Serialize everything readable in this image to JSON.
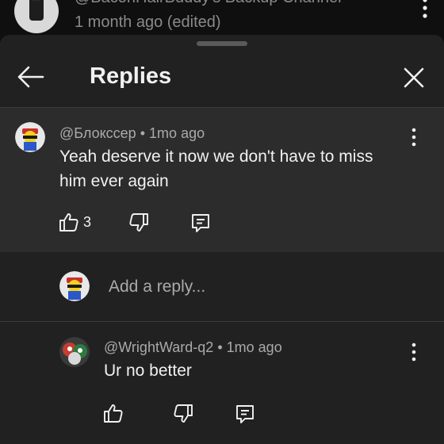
{
  "background_comment": {
    "author": "@BaconHairBuddy's Backup Channel",
    "time": "1 month ago (edited)"
  },
  "sheet": {
    "title": "Replies",
    "back_icon": "arrow-left-icon",
    "close_icon": "close-icon"
  },
  "main_comment": {
    "author": "@Блокссер",
    "time": "1mo ago",
    "separator": "•",
    "text": "Yeah deserve it now we don't have to miss him ever again",
    "likes": "3"
  },
  "reply_input": {
    "placeholder": "Add a reply..."
  },
  "replies": [
    {
      "author": "@WrightWard-q2",
      "time": "1mo ago",
      "separator": "•",
      "text": "Ur no better"
    }
  ],
  "colors": {
    "background": "#0f0f0f",
    "sheet": "#212121",
    "highlighted_comment": "#2c2c2c",
    "secondary_text": "#aaaaaa",
    "primary_text": "#f1f1f1"
  }
}
